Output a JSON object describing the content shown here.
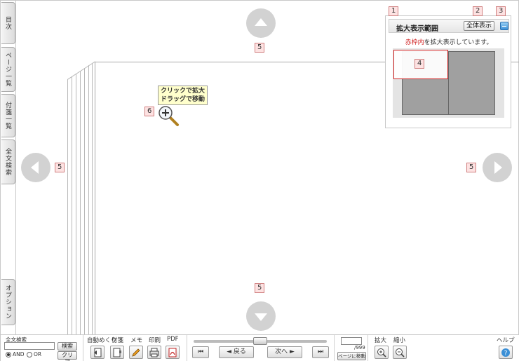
{
  "sidebar": {
    "tabs": [
      {
        "label": "目次"
      },
      {
        "label": "ページ一覧"
      },
      {
        "label": "付箋一覧"
      },
      {
        "label": "全文検索"
      },
      {
        "label": "オプション"
      }
    ]
  },
  "markers": {
    "m1": "1",
    "m2": "2",
    "m3": "3",
    "m4": "4",
    "m5_top": "5",
    "m5_left": "5",
    "m5_right": "5",
    "m5_bottom": "5",
    "m6": "6"
  },
  "viewer": {
    "tooltip_line1": "クリックで拡大",
    "tooltip_line2": "ドラッグで移動"
  },
  "zoom_panel": {
    "title": "拡大表示範囲",
    "show_all_label": "全体表示",
    "message_red": "赤枠内",
    "message_rest": "を拡大表示しています。"
  },
  "toolbar": {
    "search": {
      "label": "全文検索",
      "value": "",
      "search_button": "検索",
      "clear_button": "クリア",
      "and_label": "AND",
      "or_label": "OR",
      "mode": "AND"
    },
    "tools": {
      "auto_flip": "自動めくり",
      "sticky": "付箋",
      "memo": "メモ",
      "print": "印刷",
      "pdf": "PDF"
    },
    "navigation": {
      "back_label": "◄ 戻る",
      "next_label": "次へ ►",
      "first_symbol": "⏮",
      "last_symbol": "⏭"
    },
    "page_jump": {
      "value": "",
      "total": "/999",
      "go_label": "ページに移動"
    },
    "zoom": {
      "zoom_in_label": "拡大",
      "zoom_out_label": "縮小"
    },
    "help_label": "ヘルプ"
  },
  "colors": {
    "marker_bg": "#fde2e2",
    "marker_border": "#d08080",
    "nav_circle": "#d2d2d2",
    "red_frame": "#d02020",
    "help_icon": "#3b8fd6"
  }
}
